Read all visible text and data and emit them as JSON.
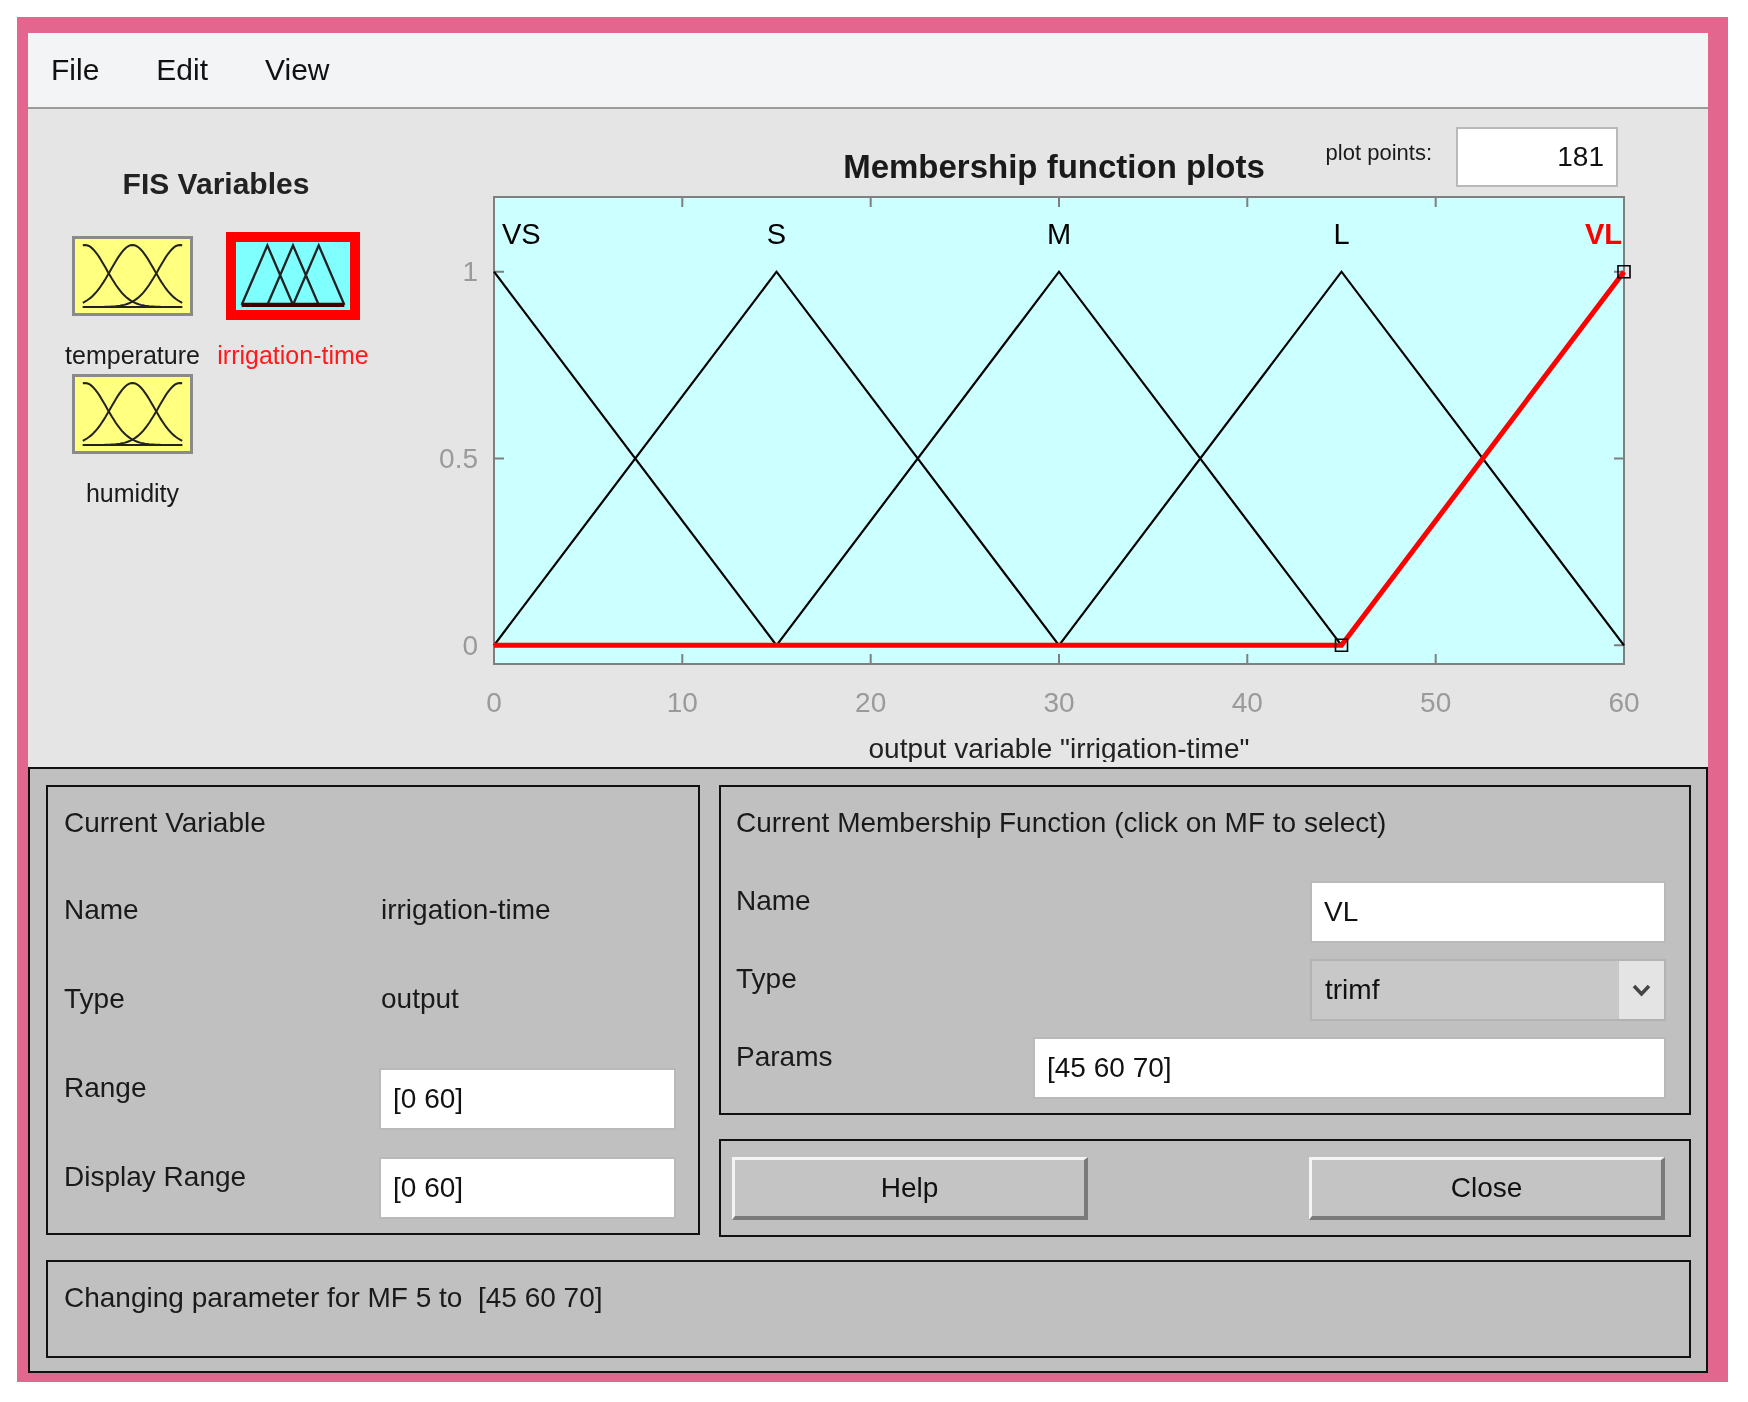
{
  "menu": [
    "File",
    "Edit",
    "View"
  ],
  "fis_variables": {
    "title": "FIS Variables",
    "items": [
      {
        "label": "temperature",
        "kind": "input",
        "selected": false
      },
      {
        "label": "irrigation-time",
        "kind": "output",
        "selected": true
      },
      {
        "label": "humidity",
        "kind": "input",
        "selected": false
      }
    ]
  },
  "plot": {
    "plot_points_label": "plot points:",
    "plot_points": "181",
    "chart_data": {
      "type": "line",
      "title": "Membership function plots",
      "xlabel": "output variable \"irrigation-time\"",
      "x": [
        0,
        15,
        30,
        45,
        60
      ],
      "series": [
        {
          "name": "VS",
          "color": "#000000",
          "values": [
            1,
            0,
            null,
            null,
            null
          ]
        },
        {
          "name": "S",
          "color": "#000000",
          "values": [
            0,
            1,
            0,
            null,
            null
          ]
        },
        {
          "name": "M",
          "color": "#000000",
          "values": [
            null,
            0,
            1,
            0,
            null
          ]
        },
        {
          "name": "L",
          "color": "#000000",
          "values": [
            null,
            null,
            0,
            1,
            0
          ]
        },
        {
          "name": "VL",
          "color": "#ff0000",
          "values": [
            0,
            0,
            0,
            0,
            1
          ]
        }
      ],
      "xlim": [
        0,
        60
      ],
      "ylim": [
        -0.05,
        1.2
      ],
      "xticks": [
        0,
        10,
        20,
        30,
        40,
        50,
        60
      ],
      "yticks": [
        0,
        0.5,
        1
      ]
    }
  },
  "current_variable": {
    "title": "Current Variable",
    "fields": [
      {
        "label": "Name",
        "value": "irrigation-time",
        "kind": "text"
      },
      {
        "label": "Type",
        "value": "output",
        "kind": "text"
      },
      {
        "label": "Range",
        "value": "[0 60]",
        "kind": "input"
      },
      {
        "label": "Display Range",
        "value": "[0 60]",
        "kind": "input"
      }
    ]
  },
  "current_mf": {
    "title": "Current Membership Function (click on MF to select)",
    "fields": [
      {
        "label": "Name",
        "value": "VL",
        "kind": "input"
      },
      {
        "label": "Type",
        "value": "trimf",
        "kind": "dropdown"
      },
      {
        "label": "Params",
        "value": "[45 60 70]",
        "kind": "long_input"
      }
    ]
  },
  "buttons": [
    "Help",
    "Close"
  ],
  "status": "Changing parameter for MF 5 to  [45 60 70]"
}
